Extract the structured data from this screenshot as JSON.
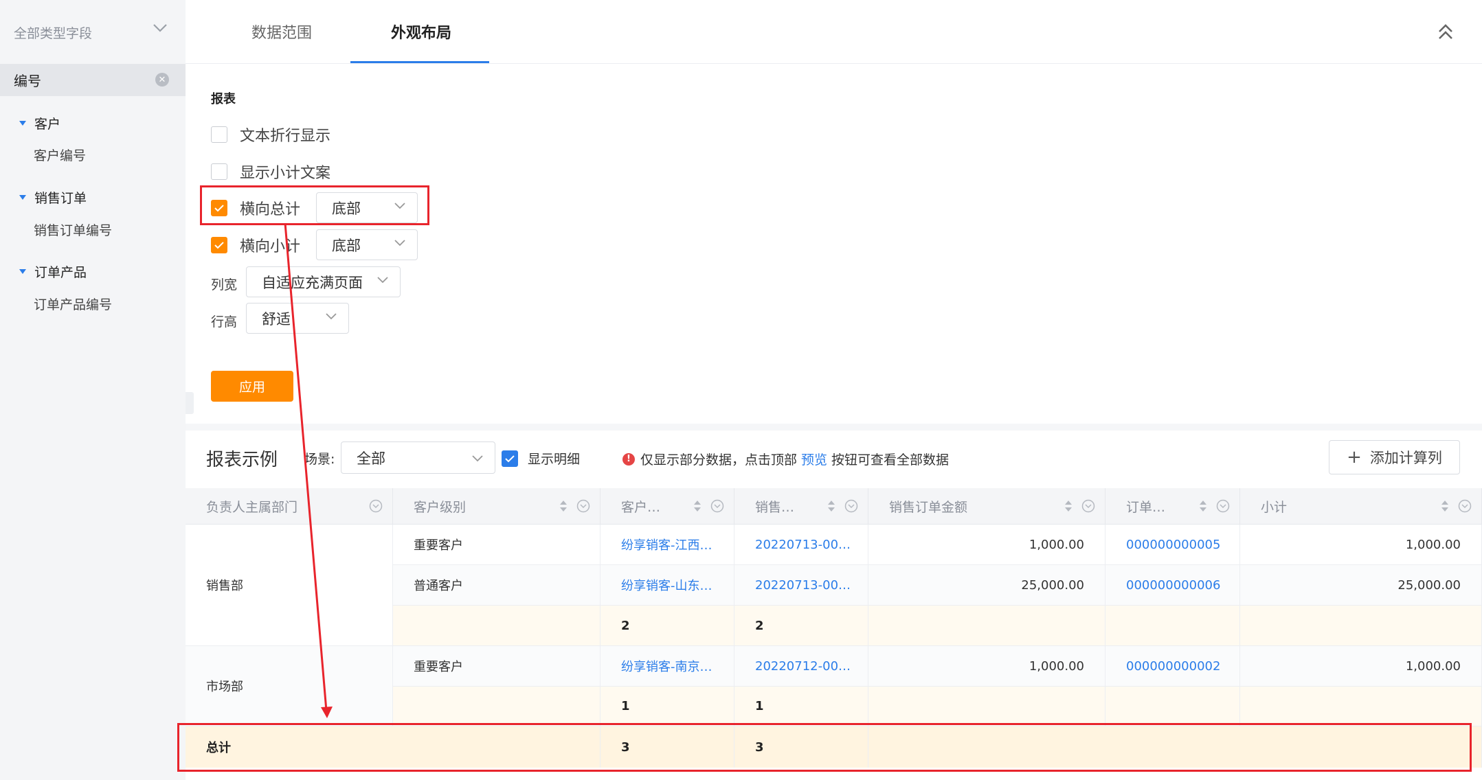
{
  "sidebar": {
    "dropdown_label": "全部类型字段",
    "search_value": "编号",
    "groups": [
      {
        "label": "客户",
        "child": "客户编号"
      },
      {
        "label": "销售订单",
        "child": "销售订单编号"
      },
      {
        "label": "订单产品",
        "child": "订单产品编号"
      }
    ]
  },
  "tabs": [
    "数据范围",
    "外观布局"
  ],
  "report": {
    "section_title": "报表",
    "opt_wrap": "文本折行显示",
    "opt_subtotal_text": "显示小计文案",
    "opt_h_total": "横向总计",
    "opt_h_total_pos": "底部",
    "opt_h_subtotal": "横向小计",
    "opt_h_subtotal_pos": "底部",
    "col_width_label": "列宽",
    "col_width_value": "自适应充满页面",
    "row_height_label": "行高",
    "row_height_value": "舒适",
    "apply_label": "应用"
  },
  "example": {
    "title": "报表示例",
    "scene_label": "场景:",
    "scene_value": "全部",
    "show_detail": "显示明细",
    "hint_before": "仅显示部分数据，点击顶部",
    "hint_link": "预览",
    "hint_after": "按钮可查看全部数据",
    "add_col": "添加计算列"
  },
  "table": {
    "headers": [
      "负责人主属部门",
      "客户级别",
      "客户…",
      "销售…",
      "销售订单金额",
      "订单…",
      "小计"
    ],
    "rows": [
      {
        "level": "重要客户",
        "customer": "纷享销客-江西…",
        "order": "20220713-00…",
        "amount": "1,000.00",
        "product": "000000000005",
        "subtotal": "1,000.00"
      },
      {
        "level": "普通客户",
        "customer": "纷享销客-山东…",
        "order": "20220713-00…",
        "amount": "25,000.00",
        "product": "000000000006",
        "subtotal": "25,000.00"
      },
      {
        "level": "重要客户",
        "customer": "纷享销客-南京…",
        "order": "20220712-00…",
        "amount": "1,000.00",
        "product": "000000000002",
        "subtotal": "1,000.00"
      }
    ],
    "dept_sales": "销售部",
    "dept_market": "市场部",
    "sales_sub": [
      "2",
      "2"
    ],
    "market_sub": [
      "1",
      "1"
    ],
    "total_label": "总计",
    "total_values": [
      "3",
      "3"
    ]
  },
  "colors": {
    "accent": "#2b7de9",
    "orange": "#ff8a00",
    "annotation": "#e8242c"
  }
}
